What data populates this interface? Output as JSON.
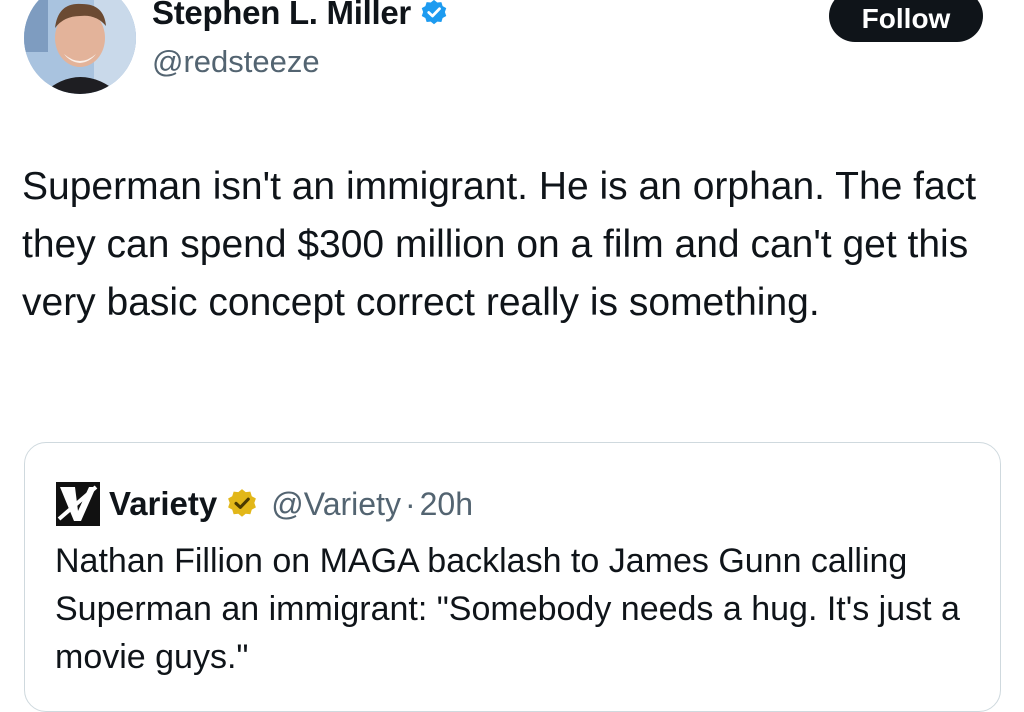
{
  "author": {
    "name": "Stephen L. Miller",
    "handle": "@redsteeze",
    "verified_icon": "verified-badge-icon",
    "verified_color": "#1d9bf0",
    "avatar_icon": "profile-photo"
  },
  "follow_button": {
    "label": "Follow",
    "bg_color": "#0f1419"
  },
  "tweet": {
    "text": "Superman isn't an immigrant. He is an orphan. The fact they can spend $300 million on a film and can't get this very basic concept correct really is something."
  },
  "quoted_tweet": {
    "logo_icon": "variety-logo",
    "name": "Variety",
    "verified_icon": "gold-verified-badge-icon",
    "verified_color": "#e2b719",
    "handle": "@Variety",
    "separator": "·",
    "time": "20h",
    "text": "Nathan Fillion on MAGA backlash to James Gunn calling Superman an immigrant: \"Somebody needs a hug. It's just a movie guys.\""
  },
  "colors": {
    "text": "#0f1419",
    "secondary": "#536471",
    "border": "#cfd9de",
    "background": "#ffffff"
  }
}
